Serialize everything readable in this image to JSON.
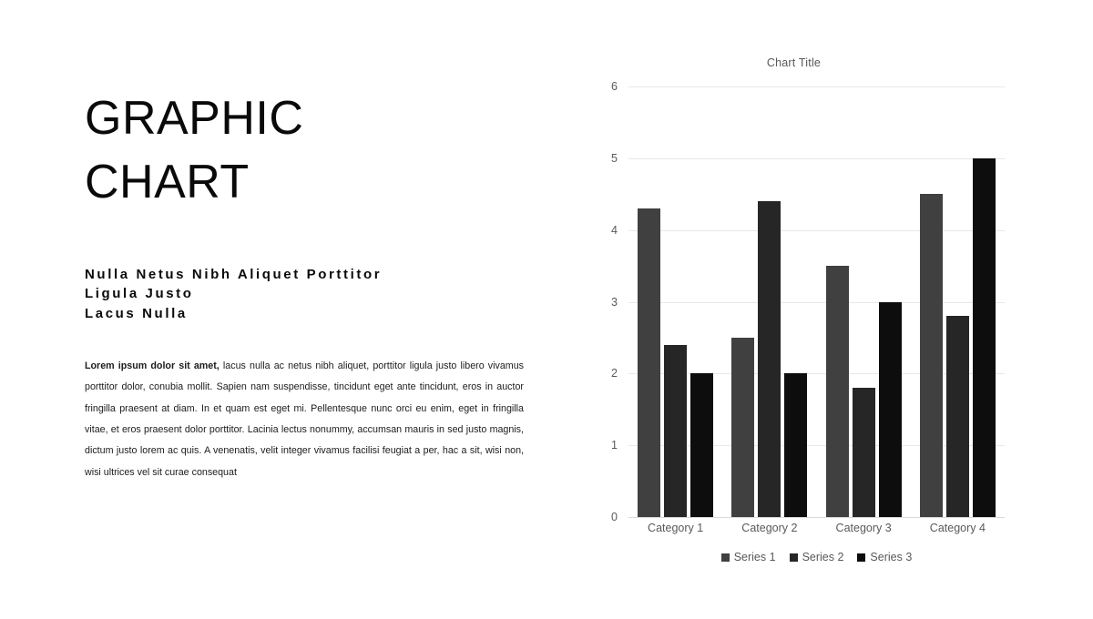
{
  "slide": {
    "title_lines": [
      "GRAPHIC",
      "CHART"
    ],
    "subheading_lines": [
      "Nulla Netus Nibh Aliquet Porttitor",
      "Ligula Justo",
      "Lacus Nulla"
    ],
    "body": {
      "lead": "Lorem ipsum dolor sit amet,",
      "rest": " lacus nulla ac netus nibh aliquet, porttitor ligula justo libero vivamus porttitor dolor, conubia mollit. Sapien nam suspendisse, tincidunt eget ante tincidunt, eros in auctor fringilla praesent at diam. In et quam est eget mi. Pellentesque nunc orci eu enim, eget in fringilla vitae, et eros praesent dolor porttitor. Lacinia lectus nonummy, accumsan mauris in sed justo magnis, dictum justo lorem ac quis. A venenatis, velit integer vivamus facilisi feugiat a per, hac a sit, wisi non, wisi ultrices vel sit curae consequat"
    }
  },
  "chart_data": {
    "type": "bar",
    "title": "Chart Title",
    "xlabel": "",
    "ylabel": "",
    "categories": [
      "Category 1",
      "Category 2",
      "Category 3",
      "Category 4"
    ],
    "series": [
      {
        "name": "Series 1",
        "color": "#404040",
        "values": [
          4.3,
          2.5,
          3.5,
          4.5
        ]
      },
      {
        "name": "Series 2",
        "color": "#262626",
        "values": [
          2.4,
          4.4,
          1.8,
          2.8
        ]
      },
      {
        "name": "Series 3",
        "color": "#0d0d0d",
        "values": [
          2.0,
          2.0,
          3.0,
          5.0
        ]
      }
    ],
    "ylim": [
      0,
      6
    ],
    "yticks": [
      0,
      1,
      2,
      3,
      4,
      5,
      6
    ],
    "grid": true,
    "legend_position": "bottom",
    "gridline_color": "#e8e8e8",
    "tick_label_color": "#595959"
  }
}
